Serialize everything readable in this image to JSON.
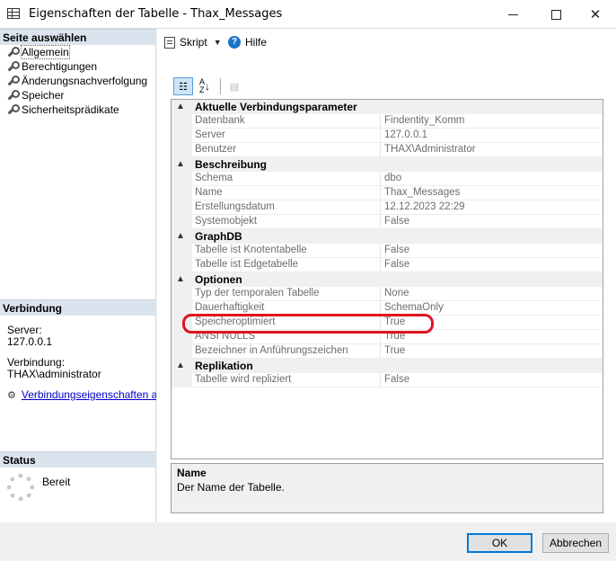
{
  "window": {
    "title": "Eigenschaften der Tabelle - Thax_Messages",
    "controls": {
      "minimize": "—",
      "maximize": "☐",
      "close": "✕"
    }
  },
  "left_panel": {
    "select_page_header": "Seite auswählen",
    "pages": [
      {
        "label": "Allgemein",
        "selected": true
      },
      {
        "label": "Berechtigungen",
        "selected": false
      },
      {
        "label": "Änderungsnachverfolgung",
        "selected": false
      },
      {
        "label": "Speicher",
        "selected": false
      },
      {
        "label": "Sicherheitsprädikate",
        "selected": false
      }
    ],
    "connection_header": "Verbindung",
    "server_label": "Server:",
    "server_value": "127.0.0.1",
    "connection_label": "Verbindung:",
    "connection_value": "THAX\\administrator",
    "connection_link": "Verbindungseigenschaften anzeigen",
    "status_header": "Status",
    "status_value": "Bereit"
  },
  "toolbar": {
    "script_label": "Skript",
    "help_label": "Hilfe"
  },
  "property_toolbar": {
    "categorized_icon": "categorized-icon",
    "alphabetical_icon": "alphabetical-icon",
    "pages_icon": "property-pages-icon"
  },
  "grid": {
    "categories": [
      {
        "name": "Aktuelle Verbindungsparameter",
        "properties": [
          {
            "name": "Datenbank",
            "value": "Findentity_Komm"
          },
          {
            "name": "Server",
            "value": "127.0.0.1"
          },
          {
            "name": "Benutzer",
            "value": "THAX\\Administrator"
          }
        ]
      },
      {
        "name": "Beschreibung",
        "properties": [
          {
            "name": "Schema",
            "value": "dbo"
          },
          {
            "name": "Name",
            "value": "Thax_Messages"
          },
          {
            "name": "Erstellungsdatum",
            "value": "12.12.2023 22:29"
          },
          {
            "name": "Systemobjekt",
            "value": "False"
          }
        ]
      },
      {
        "name": "GraphDB",
        "properties": [
          {
            "name": "Tabelle ist Knotentabelle",
            "value": "False"
          },
          {
            "name": "Tabelle ist Edgetabelle",
            "value": "False"
          }
        ]
      },
      {
        "name": "Optionen",
        "properties": [
          {
            "name": "Typ der temporalen Tabelle",
            "value": "None"
          },
          {
            "name": "Dauerhaftigkeit",
            "value": "SchemaOnly"
          },
          {
            "name": "Speicheroptimiert",
            "value": "True"
          },
          {
            "name": "ANSI NULLS",
            "value": "True"
          },
          {
            "name": "Bezeichner in Anführungszeichen",
            "value": "True"
          }
        ]
      },
      {
        "name": "Replikation",
        "properties": [
          {
            "name": "Tabelle wird repliziert",
            "value": "False"
          }
        ]
      }
    ],
    "highlight_color": "#e0141e"
  },
  "description": {
    "title": "Name",
    "text": "Der Name der Tabelle."
  },
  "buttons": {
    "ok": "OK",
    "cancel": "Abbrechen"
  }
}
